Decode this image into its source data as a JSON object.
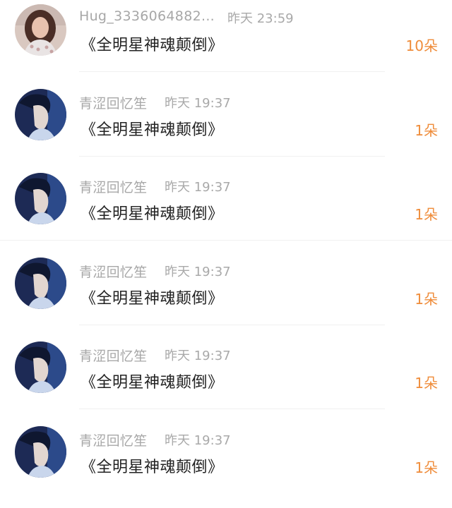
{
  "notifications": [
    {
      "username": "Hug_3336064882...",
      "time": "昨天 23:59",
      "gift_text": "《全明星神魂颠倒》",
      "count": "10朵",
      "avatar": "female-photo-avatar"
    },
    {
      "username": "青涩回忆笙",
      "time": "昨天 19:37",
      "gift_text": "《全明星神魂颠倒》",
      "count": "1朵",
      "avatar": "male-profile-avatar"
    },
    {
      "username": "青涩回忆笙",
      "time": "昨天 19:37",
      "gift_text": "《全明星神魂颠倒》",
      "count": "1朵",
      "avatar": "male-profile-avatar"
    },
    {
      "username": "青涩回忆笙",
      "time": "昨天 19:37",
      "gift_text": "《全明星神魂颠倒》",
      "count": "1朵",
      "avatar": "male-profile-avatar"
    },
    {
      "username": "青涩回忆笙",
      "time": "昨天 19:37",
      "gift_text": "《全明星神魂颠倒》",
      "count": "1朵",
      "avatar": "male-profile-avatar"
    },
    {
      "username": "青涩回忆笙",
      "time": "昨天 19:37",
      "gift_text": "《全明星神魂颠倒》",
      "count": "1朵",
      "avatar": "male-profile-avatar"
    }
  ],
  "colors": {
    "count_accent": "#ef8c3a",
    "meta_text": "#a7a7a7",
    "main_text": "#222222"
  }
}
